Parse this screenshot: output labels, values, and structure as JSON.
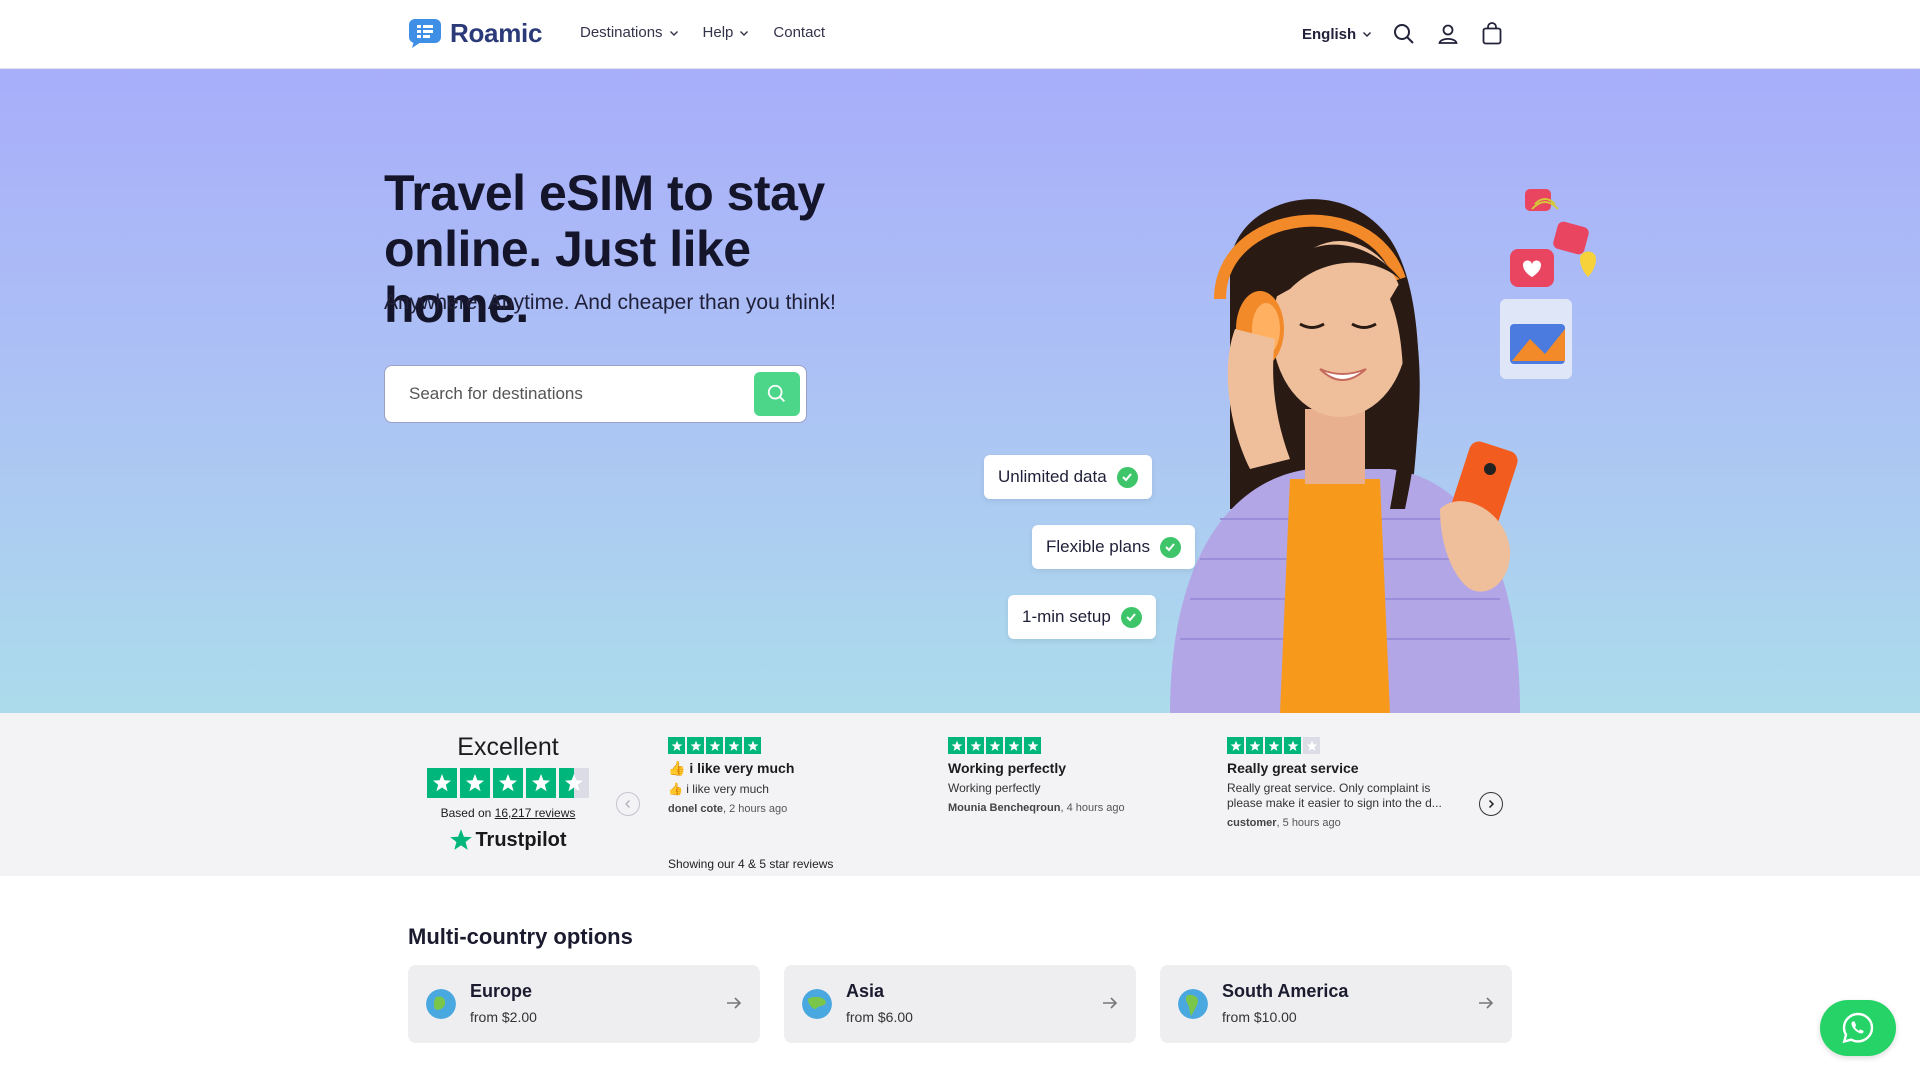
{
  "header": {
    "brand": "Roamic",
    "nav": [
      {
        "label": "Destinations",
        "has_dropdown": true
      },
      {
        "label": "Help",
        "has_dropdown": true
      },
      {
        "label": "Contact",
        "has_dropdown": false
      }
    ],
    "language": "English",
    "icons": [
      "search-icon",
      "account-icon",
      "cart-icon"
    ]
  },
  "hero": {
    "title": "Travel eSIM to stay online. Just like home.",
    "subtitle": "Anywhere. Anytime. And cheaper than you think!",
    "search_placeholder": "Search for destinations",
    "features": [
      "Unlimited data",
      "Flexible plans",
      "1-min setup"
    ]
  },
  "trustpilot": {
    "rating_word": "Excellent",
    "stars": 4.5,
    "based_on_prefix": "Based on",
    "review_count": "16,217 reviews",
    "brand": "Trustpilot",
    "showing_note": "Showing our 4 & 5 star reviews",
    "reviews": [
      {
        "stars": 5,
        "title": "👍 i like very much",
        "body": "👍 i like very much",
        "author": "donel cote",
        "time": ", 2 hours ago"
      },
      {
        "stars": 5,
        "title": "Working perfectly",
        "body": "Working perfectly",
        "author": "Mounia Bencheqroun",
        "time": ", 4 hours ago"
      },
      {
        "stars": 4,
        "title": "Really great service",
        "body": "Really great service. Only complaint is please make it easier to sign into the d...",
        "author": "customer",
        "time": ", 5 hours ago"
      }
    ]
  },
  "multi_country": {
    "title": "Multi-country options",
    "regions": [
      {
        "name": "Europe",
        "price": "from $2.00"
      },
      {
        "name": "Asia",
        "price": "from $6.00"
      },
      {
        "name": "South America",
        "price": "from $10.00"
      }
    ]
  },
  "colors": {
    "accent_green": "#4cd68a",
    "trustpilot_green": "#00b67a",
    "brand_navy": "#2b3a78",
    "whatsapp": "#25d366"
  }
}
